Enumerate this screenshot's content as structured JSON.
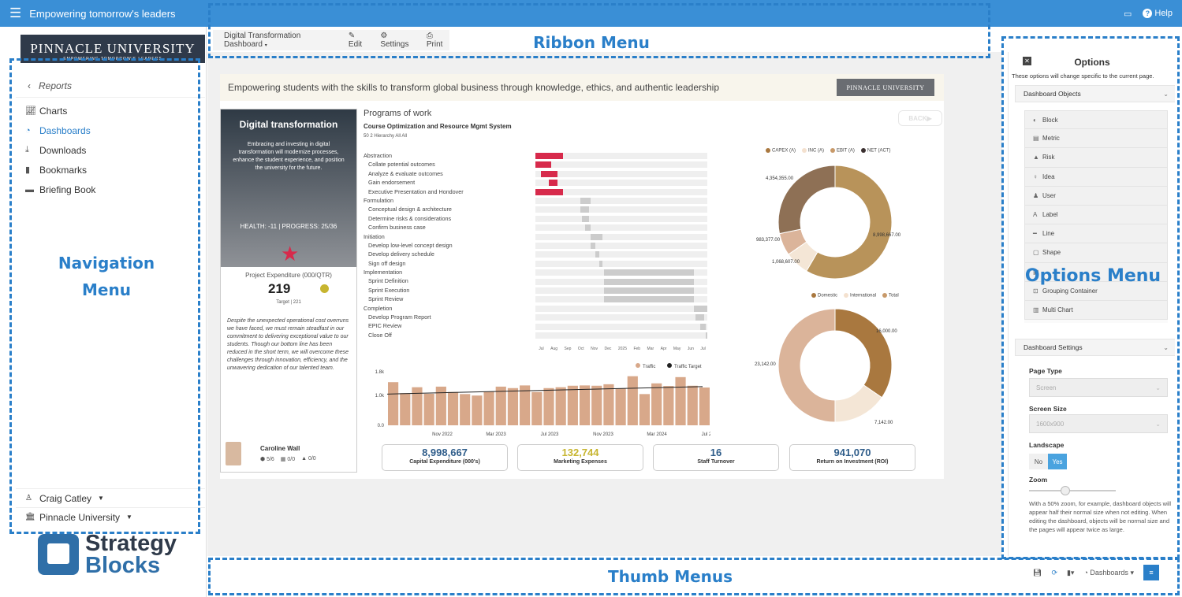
{
  "topbar": {
    "title": "Empowering tomorrow's leaders",
    "help": "Help"
  },
  "sidebar": {
    "logo": "PINNACLE UNIVERSITY",
    "logo_sub": "EMPOWERING TOMORROW'S LEADERS",
    "back": "Reports",
    "items": [
      {
        "label": "Charts",
        "icon": "chart-line-icon"
      },
      {
        "label": "Dashboards",
        "icon": "dashboard-icon"
      },
      {
        "label": "Downloads",
        "icon": "download-icon"
      },
      {
        "label": "Bookmarks",
        "icon": "bookmark-icon"
      },
      {
        "label": "Briefing Book",
        "icon": "briefcase-icon"
      }
    ],
    "user": "Craig Catley",
    "org": "Pinnacle University",
    "brand_line1": "Strategy",
    "brand_line2": "Blocks"
  },
  "ribbon": {
    "dashboard": "Digital Transformation Dashboard",
    "edit": "Edit",
    "settings": "Settings",
    "print": "Print"
  },
  "page": {
    "banner": "Empowering students with the skills to transform global business through knowledge, ethics, and authentic leadership",
    "banner_logo": "PINNACLE UNIVERSITY",
    "card": {
      "title": "Digital transformation",
      "desc": "Embracing and investing in digital transformation will modernize processes, enhance the student experience, and position the university for the future.",
      "health": "HEALTH: -11 | PROGRESS: 25/36",
      "expenditure_label": "Project Expenditure (000/QTR)",
      "expenditure_value": "219",
      "target": "Target | 221",
      "text": "Despite the unexpected operational cost overruns we have faced, we must remain steadfast in our commitment to delivering exceptional value to our students. Though our bottom line has been reduced in the short term, we will overcome these challenges through innovation, efficiency, and the unwavering dedication of our talented team.",
      "owner": "Caroline Wall",
      "stats": [
        "5/6",
        "0/0",
        "0/0"
      ]
    },
    "programs": {
      "title": "Programs of work",
      "subtitle": "Course Optimization and Resource Mgmt System",
      "meta": "50  2  Hierarchy  All  All",
      "back": "BACK",
      "rows": [
        {
          "label": "Abstraction",
          "task": false,
          "start": 0,
          "len": 0.16,
          "color": "#d72a4b"
        },
        {
          "label": "Collate potential outcomes",
          "task": true,
          "start": 0,
          "len": 0.09,
          "color": "#d72a4b"
        },
        {
          "label": "Analyze & evaluate outcomes",
          "task": true,
          "start": 0.03,
          "len": 0.1,
          "color": "#d72a4b"
        },
        {
          "label": "Gain endorsement",
          "task": true,
          "start": 0.08,
          "len": 0.05,
          "color": "#d72a4b"
        },
        {
          "label": "Executive Presentation and Hondover",
          "task": true,
          "start": 0,
          "len": 0.16,
          "color": "#d72a4b"
        },
        {
          "label": "Formulation",
          "task": false,
          "start": 0.26,
          "len": 0.06,
          "color": "#cccccc"
        },
        {
          "label": "Conceptual design & architecture",
          "task": true,
          "start": 0.26,
          "len": 0.05,
          "color": "#cccccc"
        },
        {
          "label": "Determine risks & considerations",
          "task": true,
          "start": 0.27,
          "len": 0.04,
          "color": "#cccccc"
        },
        {
          "label": "Confirm business case",
          "task": true,
          "start": 0.29,
          "len": 0.03,
          "color": "#cccccc"
        },
        {
          "label": "Initiation",
          "task": false,
          "start": 0.32,
          "len": 0.07,
          "color": "#cccccc"
        },
        {
          "label": "Develop low-level concept design",
          "task": true,
          "start": 0.32,
          "len": 0.03,
          "color": "#cccccc"
        },
        {
          "label": "Develop delivery schedule",
          "task": true,
          "start": 0.35,
          "len": 0.02,
          "color": "#cccccc"
        },
        {
          "label": "Sign off design",
          "task": true,
          "start": 0.37,
          "len": 0.02,
          "color": "#cccccc"
        },
        {
          "label": "Implementation",
          "task": false,
          "start": 0.4,
          "len": 0.52,
          "color": "#cccccc"
        },
        {
          "label": "Sprint Definition",
          "task": true,
          "start": 0.4,
          "len": 0.52,
          "color": "#cccccc"
        },
        {
          "label": "Sprint Execution",
          "task": true,
          "start": 0.4,
          "len": 0.52,
          "color": "#cccccc"
        },
        {
          "label": "Sprint Review",
          "task": true,
          "start": 0.4,
          "len": 0.52,
          "color": "#cccccc"
        },
        {
          "label": "Completion",
          "task": false,
          "start": 0.92,
          "len": 0.08,
          "color": "#cccccc"
        },
        {
          "label": "Develop Program Report",
          "task": true,
          "start": 0.93,
          "len": 0.05,
          "color": "#cccccc"
        },
        {
          "label": "EPIC Review",
          "task": true,
          "start": 0.96,
          "len": 0.03,
          "color": "#cccccc"
        },
        {
          "label": "Close Off",
          "task": true,
          "start": 0.99,
          "len": 0.01,
          "color": "#cccccc"
        }
      ],
      "axis": [
        "Jul",
        "Aug",
        "Sep",
        "Oct",
        "Nov",
        "Dec",
        "2025",
        "Feb",
        "Mar",
        "Apr",
        "May",
        "Jun",
        "Jul"
      ]
    },
    "kpis": [
      {
        "value": "8,998,667",
        "label": "Capital Expenditure (000's)",
        "color": "#2f5d8a"
      },
      {
        "value": "132,744",
        "label": "Marketing Expenses",
        "color": "#c7b530"
      },
      {
        "value": "16",
        "label": "Staff Turnover",
        "color": "#2f5d8a"
      },
      {
        "value": "941,070",
        "label": "Return on Investment (ROI)",
        "color": "#2f5d8a"
      }
    ]
  },
  "chart_data": [
    {
      "type": "bar",
      "legend": [
        "Traffic",
        "Traffic Target"
      ],
      "ticks_x": [
        "Nov 2022",
        "Mar 2023",
        "Jul 2023",
        "Nov 2023",
        "Mar 2024",
        "Jul 2024"
      ],
      "ticks_y": [
        "1.8k",
        "1.0k",
        "0.0"
      ],
      "ylim": [
        0,
        1800
      ],
      "values": [
        1450,
        1080,
        1280,
        1060,
        1300,
        1120,
        1050,
        1000,
        1130,
        1300,
        1250,
        1340,
        1120,
        1250,
        1280,
        1330,
        1340,
        1330,
        1380,
        1240,
        1650,
        1050,
        1410,
        1320,
        1620,
        1330,
        1270
      ],
      "target_start": 1050,
      "target_end": 1300,
      "color": "#d8a88a",
      "target_color": "#222222"
    },
    {
      "type": "pie",
      "legend": [
        "CAPEX (A)",
        "INC (A)",
        "EBIT (A)",
        "NET (ACT)"
      ],
      "legend_colors": [
        "#a9783f",
        "#f4e1cf",
        "#c89a6a",
        "#3b3030"
      ],
      "slices": [
        {
          "label": "8,998,667.00",
          "value": 8998667,
          "color": "#b8935a"
        },
        {
          "label": "1,068,607.00",
          "value": 1068607,
          "color": "#f4e6d6"
        },
        {
          "label": "983,377.00",
          "value": 983377,
          "color": "#dbb49a"
        },
        {
          "label": "4,354,355.00",
          "value": 4354355,
          "color": "#8e7055"
        }
      ]
    },
    {
      "type": "pie",
      "legend": [
        "Domestic",
        "International",
        "Total"
      ],
      "legend_colors": [
        "#a9783f",
        "#f4e1cf",
        "#c89a6a"
      ],
      "slices": [
        {
          "label": "16,000.00",
          "value": 16000,
          "color": "#a9783f"
        },
        {
          "label": "7,142.00",
          "value": 7142,
          "color": "#f4e6d6"
        },
        {
          "label": "23,142.00",
          "value": 23142,
          "color": "#dbb49a"
        }
      ]
    }
  ],
  "options": {
    "title": "Options",
    "desc": "These options will change specific to the current page.",
    "objects_header": "Dashboard Objects",
    "objects": [
      {
        "label": "Block",
        "icon": "block-icon"
      },
      {
        "label": "Metric",
        "icon": "metric-icon"
      },
      {
        "label": "Risk",
        "icon": "risk-icon"
      },
      {
        "label": "Idea",
        "icon": "idea-icon"
      },
      {
        "label": "User",
        "icon": "user-icon"
      },
      {
        "label": "Label",
        "icon": "label-icon"
      },
      {
        "label": "Line",
        "icon": "line-icon"
      },
      {
        "label": "Shape",
        "icon": "shape-icon"
      },
      {
        "label": "",
        "icon": "image-icon"
      },
      {
        "label": "Grouping Container",
        "icon": "group-icon"
      },
      {
        "label": "Multi Chart",
        "icon": "multichart-icon"
      }
    ],
    "settings_header": "Dashboard Settings",
    "page_type_label": "Page Type",
    "page_type": "Screen",
    "screen_size_label": "Screen Size",
    "screen_size": "1600x900",
    "landscape_label": "Landscape",
    "landscape_no": "No",
    "landscape_yes": "Yes",
    "zoom_label": "Zoom",
    "zoom_note": "With a 50% zoom, for example, dashboard objects will appear half their normal size when not editing. When editing the dashboard, objects will be normal size and the pages will appear twice as large."
  },
  "thumbs": {
    "dashboards": "Dashboards"
  },
  "overlays": {
    "ribbon": "Ribbon Menu",
    "nav1": "Navigation",
    "nav2": "Menu",
    "options": "Options Menu",
    "thumbs": "Thumb  Menus"
  },
  "colors": {
    "accent": "#2a7fc9",
    "topbar": "#3a8fd6",
    "risk": "#d72a4b"
  }
}
